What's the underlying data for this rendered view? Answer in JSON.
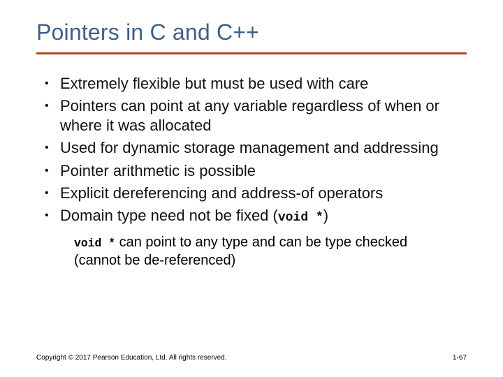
{
  "title": "Pointers in C and C++",
  "bullets": {
    "b0": "Extremely flexible but must be used with care",
    "b1": "Pointers can point at any variable regardless of when or where it was allocated",
    "b2": "Used for dynamic storage management and addressing",
    "b3": "Pointer arithmetic is possible",
    "b4": "Explicit dereferencing and address-of operators",
    "b5_pre": "Domain type need not be fixed (",
    "b5_code": "void *",
    "b5_post": ")"
  },
  "subnote": {
    "code": "void *",
    "text": " can point to any type and can be type checked (cannot be de-referenced)"
  },
  "footer": {
    "copyright": "Copyright © 2017 Pearson Education, Ltd. All rights reserved.",
    "page": "1-67"
  }
}
